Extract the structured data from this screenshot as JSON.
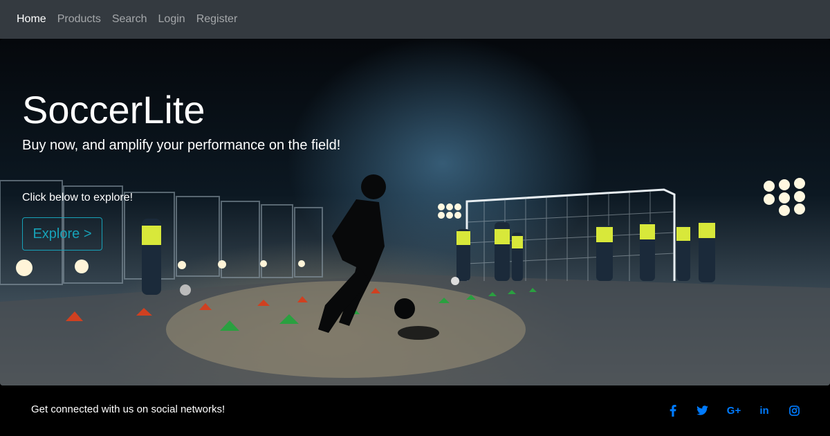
{
  "nav": {
    "items": [
      {
        "label": "Home",
        "active": true
      },
      {
        "label": "Products",
        "active": false
      },
      {
        "label": "Search",
        "active": false
      },
      {
        "label": "Login",
        "active": false
      },
      {
        "label": "Register",
        "active": false
      }
    ]
  },
  "hero": {
    "title": "SoccerLite",
    "subtitle": "Buy now, and amplify your performance on the field!",
    "note": "Click below to explore!",
    "button_label": "Explore >"
  },
  "footer": {
    "text": "Get connected with us on social networks!",
    "social": [
      {
        "icon": "facebook-icon",
        "glyph": "f"
      },
      {
        "icon": "twitter-icon",
        "glyph": "🐦"
      },
      {
        "icon": "google-plus-icon",
        "glyph": "G+"
      },
      {
        "icon": "linkedin-icon",
        "glyph": "in"
      },
      {
        "icon": "instagram-icon",
        "glyph": "◎"
      }
    ],
    "icon_color": "#007bff"
  },
  "colors": {
    "navbar_bg": "#343a40",
    "button_accent": "#17a2b8"
  }
}
